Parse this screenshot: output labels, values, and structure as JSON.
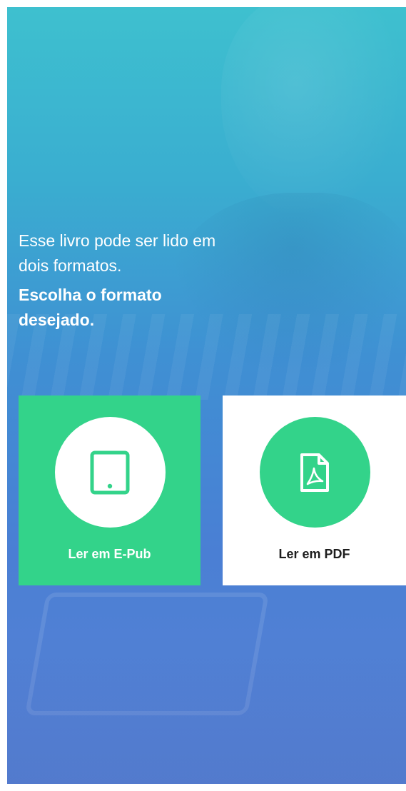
{
  "intro": {
    "line1": "Esse livro pode ser lido em",
    "line2": "dois formatos.",
    "bold1": "Escolha o formato",
    "bold2": "desejado."
  },
  "options": {
    "epub": {
      "label": "Ler em E-Pub",
      "icon": "tablet-icon"
    },
    "pdf": {
      "label": "Ler em PDF",
      "icon": "pdf-file-icon"
    }
  },
  "colors": {
    "accent_green": "#33d38a",
    "background_top": "#3ec0cf",
    "background_bottom": "#5a83d6",
    "card_white": "#ffffff",
    "pdf_label": "#1d1d1d"
  }
}
